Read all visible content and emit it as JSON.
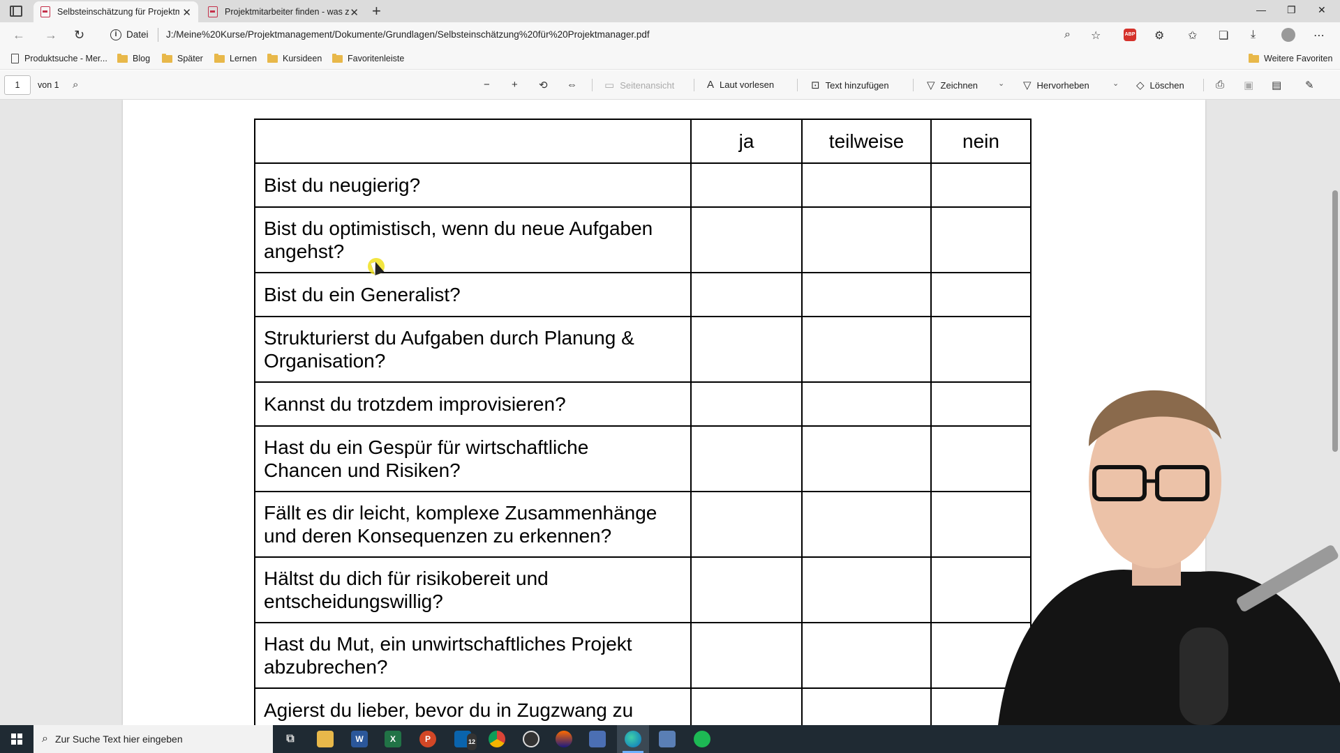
{
  "browser": {
    "tabs": [
      {
        "title": "Selbsteinschätzung für Projektm",
        "active": true
      },
      {
        "title": "Projektmitarbeiter finden - was z",
        "active": false
      }
    ],
    "address": {
      "scheme_label": "Datei",
      "url": "J:/Meine%20Kurse/Projektmanagement/Dokumente/Grundlagen/Selbsteinschätzung%20für%20Projektmanager.pdf"
    },
    "bookmarks": [
      "Produktsuche - Mer...",
      "Blog",
      "Später",
      "Lernen",
      "Kursideen",
      "Favoritenleiste"
    ],
    "bookmarks_right": "Weitere Favoriten"
  },
  "pdf_toolbar": {
    "page_current": "1",
    "page_of": "von 1",
    "page_view": "Seitenansicht",
    "read_aloud": "Laut vorlesen",
    "add_text": "Text hinzufügen",
    "draw": "Zeichnen",
    "highlight": "Hervorheben",
    "erase": "Löschen"
  },
  "document": {
    "columns": [
      "ja",
      "teilweise",
      "nein"
    ],
    "questions": [
      [
        "Bist du neugierig?"
      ],
      [
        "Bist du optimistisch, wenn du neue Aufgaben",
        "angehst?"
      ],
      [
        "Bist du ein Generalist?"
      ],
      [
        "Strukturierst du Aufgaben durch Planung &",
        "Organisation?"
      ],
      [
        "Kannst du trotzdem improvisieren?"
      ],
      [
        "Hast du ein Gespür für wirtschaftliche",
        "Chancen und Risiken?"
      ],
      [
        "Fällt es dir leicht, komplexe Zusammenhänge",
        "und deren Konsequenzen zu erkennen?"
      ],
      [
        "Hältst du dich für risikobereit und",
        "entscheidungswillig?"
      ],
      [
        "Hast du Mut, ein unwirtschaftliches Projekt",
        "abzubrechen?"
      ],
      [
        "Agierst du lieber, bevor du in Zugzwang zu"
      ]
    ]
  },
  "taskbar": {
    "search_placeholder": "Zur Suche Text hier eingeben",
    "mail_badge": "12"
  }
}
